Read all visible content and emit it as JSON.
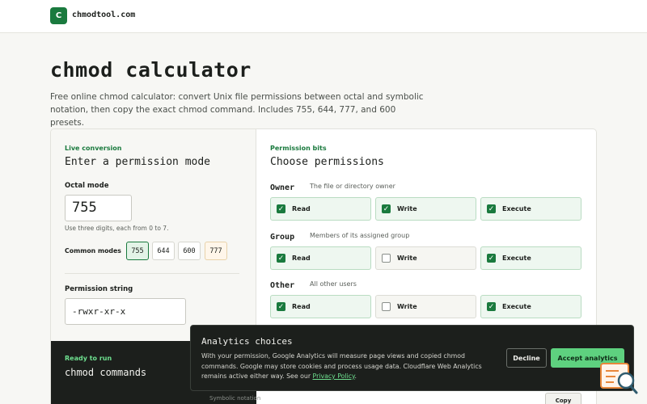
{
  "header": {
    "logo_letter": "C",
    "site_name": "chmodtool.com"
  },
  "page": {
    "title": "chmod calculator",
    "intro": "Free online chmod calculator: convert Unix file permissions between octal and symbolic notation, then copy the exact chmod command. Includes 755, 644, 777, and 600 presets."
  },
  "conversion": {
    "eyebrow": "Live conversion",
    "title": "Enter a permission mode",
    "octal_label": "Octal mode",
    "octal_value": "755",
    "hint": "Use three digits, each from 0 to 7.",
    "presets_label": "Common modes",
    "presets": [
      "755",
      "644",
      "600",
      "777"
    ],
    "perm_label": "Permission string",
    "perm_value": "-rwxr-xr-x"
  },
  "commands": {
    "eyebrow": "Ready to run",
    "title": "chmod commands",
    "symbolic_label": "Symbolic notation",
    "copy_label": "Copy"
  },
  "bits": {
    "eyebrow": "Permission bits",
    "title": "Choose permissions",
    "groups": [
      {
        "name": "Owner",
        "desc": "The file or directory owner",
        "read": "Read",
        "write": "Write",
        "execute": "Execute"
      },
      {
        "name": "Group",
        "desc": "Members of its assigned group",
        "read": "Read",
        "write": "Write",
        "execute": "Execute"
      },
      {
        "name": "Other",
        "desc": "All other users",
        "read": "Read",
        "write": "Write",
        "execute": "Execute"
      }
    ]
  },
  "consent": {
    "title": "Analytics choices",
    "text": "With your permission, Google Analytics will measure page views and copied chmod commands. Google may store cookies and process usage data. Cloudflare Web Analytics remains active either way. See our ",
    "link": "Privacy Policy",
    "text_end": ".",
    "decline": "Decline",
    "accept": "Accept analytics"
  },
  "colors": {
    "accent": "#1a7a3e",
    "accept": "#5ed17f",
    "dark": "#1c1f1c"
  }
}
